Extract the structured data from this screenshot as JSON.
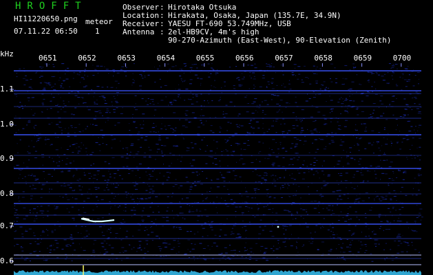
{
  "brand": "HROFFT",
  "file": {
    "name": "HI11220650.png",
    "datetime": "07.11.22 06:50",
    "meteor_label": "meteor",
    "meteor_count": "1"
  },
  "info": {
    "observer_label": "Observer",
    "observer": "Hirotaka Otsuka",
    "location_label": "Location",
    "location": "Hirakata, Osaka, Japan (135.7E, 34.9N)",
    "receiver_label": "Receiver",
    "receiver": "YAESU FT-690 53.749MHz, USB",
    "antenna_label": "Antenna",
    "antenna": "2el-HB9CV, 4m's high",
    "antenna_detail": "90-270-Azimuth (East-West), 90-Elevation (Zenith)"
  },
  "axis": {
    "unit": "kHz",
    "time_ticks": [
      "0651",
      "0652",
      "0653",
      "0654",
      "0655",
      "0656",
      "0657",
      "0658",
      "0659",
      "0700"
    ],
    "freq_ticks": [
      "1.1",
      "1.0",
      "0.9",
      "0.8",
      "0.7",
      "0.6"
    ]
  },
  "colors": {
    "background": "#000000",
    "brand": "#1fd21f",
    "text": "#ffffff",
    "noise": "#1a2bb0",
    "carrier": "#3a55ff",
    "meteor": "#d8ffff",
    "spectrum": "#35b8e8"
  },
  "meteor_events": [
    {
      "time": "06:52",
      "freq_khz": 0.726
    }
  ]
}
